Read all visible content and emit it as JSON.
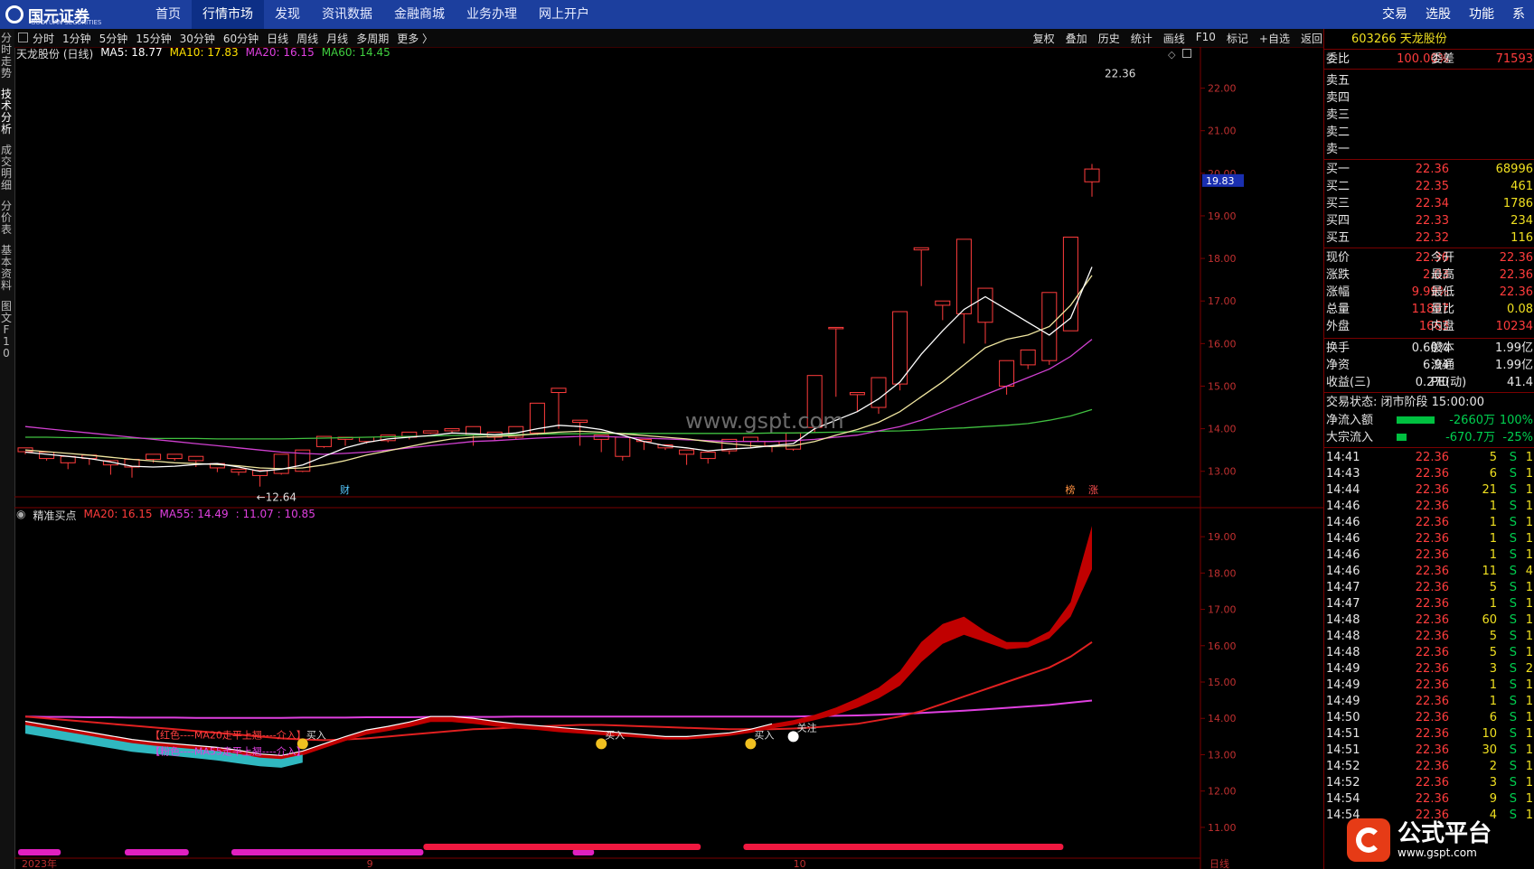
{
  "nav": {
    "logo_text": "国元证券",
    "logo_sub": "GUOYUAN SECURITIES",
    "items": [
      "首页",
      "行情市场",
      "发现",
      "资讯数据",
      "金融商城",
      "业务办理",
      "网上开户"
    ],
    "active_index": 1,
    "right_items": [
      "交易",
      "选股",
      "功能",
      "系"
    ]
  },
  "left_tabs": [
    "分时走势",
    "技术分析",
    "成交明细",
    "分价表",
    "基本资料",
    "图文F10"
  ],
  "left_tab_active": 1,
  "periods": [
    "分时",
    "1分钟",
    "5分钟",
    "15分钟",
    "30分钟",
    "60分钟",
    "日线",
    "周线",
    "月线",
    "多周期",
    "更多 〉"
  ],
  "tools": [
    "复权",
    "叠加",
    "历史",
    "统计",
    "画线",
    "F10",
    "标记",
    "+自选",
    "返回"
  ],
  "main_legend": {
    "name": "天龙股份 (日线)",
    "items": [
      {
        "text": "MA5: 18.77",
        "color": "#ffffff"
      },
      {
        "text": "MA10: 17.83",
        "color": "#ffe000"
      },
      {
        "text": "MA20: 16.15",
        "color": "#e040e0"
      },
      {
        "text": "MA60: 14.45",
        "color": "#40d040"
      }
    ]
  },
  "sub_legend": {
    "name": "精准买点",
    "items": [
      {
        "text": "MA20: 16.15",
        "color": "#ff3c3c"
      },
      {
        "text": "MA55: 14.49",
        "color": "#e040e0"
      },
      {
        "text": ": 11.07 : 10.85",
        "color": "#e040e0"
      }
    ]
  },
  "price_axis": [
    "22.00",
    "21.00",
    "20.00",
    "19.00",
    "18.00",
    "17.00",
    "16.00",
    "15.00",
    "14.00",
    "13.00"
  ],
  "price_marker": "19.83",
  "sub_axis": [
    "19.00",
    "18.00",
    "17.00",
    "16.00",
    "15.00",
    "14.00",
    "13.00",
    "12.00",
    "11.00"
  ],
  "high_label": "22.36",
  "low_label": "12.64",
  "badges": {
    "cai": "财",
    "bang": "榜",
    "zhang": "涨"
  },
  "annotations": {
    "red_text": "【红色----MA20走平上翘----介入】",
    "pink_text": "【粉色----MA55走平上翘----介入】",
    "buy1": "买入",
    "buy2": "买入",
    "buy3": "买入",
    "watch": "关注"
  },
  "date_labels": [
    "2023年",
    "9",
    "10"
  ],
  "axis_unit": "日线",
  "watermark": "www.gspt.com",
  "quote": {
    "title": "603266 天龙股份",
    "weibi_label": "委比",
    "weibi": "100.00%",
    "weicha_label": "委差",
    "weicha": "71593",
    "asks": [
      "卖五",
      "卖四",
      "卖三",
      "卖二",
      "卖一"
    ],
    "bids": [
      {
        "label": "买一",
        "price": "22.36",
        "vol": "68996"
      },
      {
        "label": "买二",
        "price": "22.35",
        "vol": "461"
      },
      {
        "label": "买三",
        "price": "22.34",
        "vol": "1786"
      },
      {
        "label": "买四",
        "price": "22.33",
        "vol": "234"
      },
      {
        "label": "买五",
        "price": "22.32",
        "vol": "116"
      }
    ],
    "stats": [
      {
        "l1": "现价",
        "v1": "22.36",
        "l2": "今开",
        "v2": "22.36"
      },
      {
        "l1": "涨跌",
        "v1": "2.03",
        "l2": "最高",
        "v2": "22.36"
      },
      {
        "l1": "涨幅",
        "v1": "9.99%",
        "l2": "最低",
        "v2": "22.36"
      },
      {
        "l1": "总量",
        "v1": "11897",
        "l2": "量比",
        "v2": "0.08"
      },
      {
        "l1": "外盘",
        "v1": "1663",
        "l2": "内盘",
        "v2": "10234"
      }
    ],
    "stats2": [
      {
        "l1": "换手",
        "v1": "0.60%",
        "l2": "股本",
        "v2": "1.99亿"
      },
      {
        "l1": "净资",
        "v1": "6.94",
        "l2": "流通",
        "v2": "1.99亿"
      },
      {
        "l1": "收益(三)",
        "v1": "0.270",
        "l2": "PE(动)",
        "v2": "41.4"
      }
    ],
    "trade_status": "交易状态: 闭市阶段 15:00:00",
    "flows": [
      {
        "label": "净流入额",
        "value": "-2660万",
        "pct": "100%",
        "bar": 0.7
      },
      {
        "label": "大宗流入",
        "value": "-670.7万",
        "pct": "-25%",
        "bar": 0.18
      }
    ],
    "ticks": [
      [
        "14:41",
        "22.36",
        "5",
        "S",
        "1"
      ],
      [
        "14:43",
        "22.36",
        "6",
        "S",
        "1"
      ],
      [
        "14:44",
        "22.36",
        "21",
        "S",
        "1"
      ],
      [
        "14:46",
        "22.36",
        "1",
        "S",
        "1"
      ],
      [
        "14:46",
        "22.36",
        "1",
        "S",
        "1"
      ],
      [
        "14:46",
        "22.36",
        "1",
        "S",
        "1"
      ],
      [
        "14:46",
        "22.36",
        "1",
        "S",
        "1"
      ],
      [
        "14:46",
        "22.36",
        "11",
        "S",
        "4"
      ],
      [
        "14:47",
        "22.36",
        "5",
        "S",
        "1"
      ],
      [
        "14:47",
        "22.36",
        "1",
        "S",
        "1"
      ],
      [
        "14:48",
        "22.36",
        "60",
        "S",
        "1"
      ],
      [
        "14:48",
        "22.36",
        "5",
        "S",
        "1"
      ],
      [
        "14:48",
        "22.36",
        "5",
        "S",
        "1"
      ],
      [
        "14:49",
        "22.36",
        "3",
        "S",
        "2"
      ],
      [
        "14:49",
        "22.36",
        "1",
        "S",
        "1"
      ],
      [
        "14:49",
        "22.36",
        "1",
        "S",
        "1"
      ],
      [
        "14:50",
        "22.36",
        "6",
        "S",
        "1"
      ],
      [
        "14:51",
        "22.36",
        "10",
        "S",
        "1"
      ],
      [
        "14:51",
        "22.36",
        "30",
        "S",
        "1"
      ],
      [
        "14:52",
        "22.36",
        "2",
        "S",
        "1"
      ],
      [
        "14:52",
        "22.36",
        "3",
        "S",
        "1"
      ],
      [
        "14:54",
        "22.36",
        "9",
        "S",
        "1"
      ],
      [
        "14:54",
        "22.36",
        "4",
        "S",
        "1"
      ]
    ]
  },
  "brand": {
    "name": "公式平台",
    "url": "www.gspt.com"
  },
  "chart_data": {
    "type": "candlestick",
    "price_range": [
      12.4,
      22.5
    ],
    "candles": [
      [
        13.46,
        13.55,
        13.4,
        13.5
      ],
      [
        13.3,
        13.45,
        13.25,
        13.4
      ],
      [
        13.2,
        13.35,
        13.05,
        13.1
      ],
      [
        13.3,
        13.38,
        13.15,
        13.22
      ],
      [
        13.15,
        13.25,
        12.92,
        12.98
      ],
      [
        13.1,
        13.28,
        12.85,
        12.92
      ],
      [
        13.28,
        13.4,
        13.2,
        13.35
      ],
      [
        13.3,
        13.4,
        13.25,
        13.3
      ],
      [
        13.25,
        13.35,
        13.1,
        13.25
      ],
      [
        13.08,
        13.18,
        12.98,
        13.02
      ],
      [
        12.98,
        13.05,
        12.9,
        12.98
      ],
      [
        12.9,
        13.02,
        12.64,
        12.7
      ],
      [
        12.95,
        13.4,
        12.92,
        13.35
      ],
      [
        13.0,
        13.5,
        12.98,
        13.45
      ],
      [
        13.58,
        13.82,
        13.55,
        13.75
      ],
      [
        13.75,
        13.8,
        13.6,
        13.72
      ],
      [
        13.7,
        13.8,
        13.65,
        13.75
      ],
      [
        13.72,
        13.85,
        13.68,
        13.8
      ],
      [
        13.8,
        13.92,
        13.75,
        13.85
      ],
      [
        13.9,
        13.95,
        13.88,
        13.92
      ],
      [
        13.95,
        14.0,
        13.9,
        13.95
      ],
      [
        13.85,
        14.05,
        13.6,
        13.65
      ],
      [
        13.8,
        13.92,
        13.72,
        13.88
      ],
      [
        13.8,
        14.05,
        13.75,
        14.0
      ],
      [
        13.9,
        14.6,
        13.85,
        14.55
      ],
      [
        14.85,
        14.95,
        14.0,
        14.05
      ],
      [
        14.15,
        14.2,
        13.6,
        13.75
      ],
      [
        13.75,
        13.85,
        13.45,
        13.5
      ],
      [
        13.35,
        13.8,
        13.25,
        13.78
      ],
      [
        13.7,
        13.75,
        13.5,
        13.55
      ],
      [
        13.55,
        13.62,
        13.5,
        13.56
      ],
      [
        13.4,
        13.5,
        13.15,
        13.2
      ],
      [
        13.3,
        13.45,
        13.18,
        13.4
      ],
      [
        13.48,
        13.75,
        13.4,
        13.7
      ],
      [
        13.7,
        13.8,
        13.55,
        13.72
      ],
      [
        13.6,
        13.7,
        13.45,
        13.5
      ],
      [
        13.52,
        13.9,
        13.48,
        13.8
      ],
      [
        14.03,
        15.25,
        13.9,
        15.22
      ],
      [
        16.35,
        16.38,
        14.75,
        14.8
      ],
      [
        14.8,
        14.85,
        14.4,
        14.45
      ],
      [
        14.5,
        15.2,
        14.35,
        15.15
      ],
      [
        15.05,
        16.75,
        14.9,
        16.65
      ],
      [
        18.2,
        18.25,
        17.35,
        17.35
      ],
      [
        16.9,
        17.0,
        16.55,
        16.8
      ],
      [
        16.7,
        18.45,
        16.0,
        17.75
      ],
      [
        16.5,
        17.3,
        16.0,
        16.0
      ],
      [
        15.0,
        15.6,
        14.8,
        15.25
      ],
      [
        15.5,
        15.85,
        15.4,
        15.85
      ],
      [
        15.6,
        17.2,
        15.5,
        16.75
      ],
      [
        16.3,
        18.5,
        16.3,
        18.5
      ],
      [
        19.8,
        20.1,
        19.45,
        20.22
      ]
    ],
    "ma5": [
      13.45,
      13.4,
      13.35,
      13.3,
      13.22,
      13.12,
      13.1,
      13.12,
      13.16,
      13.18,
      13.1,
      13.0,
      13.05,
      13.15,
      13.35,
      13.55,
      13.68,
      13.76,
      13.8,
      13.84,
      13.9,
      13.88,
      13.86,
      13.9,
      14.0,
      14.08,
      14.05,
      13.98,
      13.85,
      13.7,
      13.6,
      13.55,
      13.48,
      13.52,
      13.55,
      13.6,
      13.65,
      14.0,
      14.2,
      14.4,
      14.7,
      15.1,
      15.75,
      16.3,
      16.8,
      17.1,
      16.8,
      16.5,
      16.2,
      16.6,
      17.8
    ],
    "ma10": [
      13.5,
      13.46,
      13.42,
      13.38,
      13.33,
      13.28,
      13.24,
      13.2,
      13.18,
      13.16,
      13.13,
      13.08,
      13.06,
      13.08,
      13.15,
      13.25,
      13.38,
      13.48,
      13.58,
      13.68,
      13.76,
      13.8,
      13.82,
      13.84,
      13.88,
      13.92,
      13.94,
      13.92,
      13.88,
      13.84,
      13.8,
      13.76,
      13.7,
      13.65,
      13.6,
      13.58,
      13.6,
      13.7,
      13.85,
      13.98,
      14.15,
      14.4,
      14.75,
      15.1,
      15.5,
      15.9,
      16.1,
      16.2,
      16.4,
      16.9,
      17.6
    ],
    "ma20": [
      14.05,
      14.0,
      13.95,
      13.9,
      13.85,
      13.8,
      13.75,
      13.7,
      13.65,
      13.6,
      13.55,
      13.5,
      13.45,
      13.42,
      13.4,
      13.42,
      13.45,
      13.5,
      13.55,
      13.6,
      13.65,
      13.7,
      13.72,
      13.75,
      13.78,
      13.8,
      13.82,
      13.82,
      13.8,
      13.78,
      13.76,
      13.74,
      13.72,
      13.7,
      13.7,
      13.7,
      13.72,
      13.75,
      13.8,
      13.85,
      13.95,
      14.05,
      14.2,
      14.4,
      14.6,
      14.8,
      15.0,
      15.2,
      15.4,
      15.7,
      16.1
    ],
    "ma60": [
      13.8,
      13.8,
      13.79,
      13.79,
      13.78,
      13.78,
      13.77,
      13.77,
      13.77,
      13.76,
      13.76,
      13.76,
      13.76,
      13.77,
      13.78,
      13.79,
      13.8,
      13.81,
      13.82,
      13.83,
      13.84,
      13.85,
      13.86,
      13.86,
      13.87,
      13.88,
      13.88,
      13.89,
      13.89,
      13.89,
      13.89,
      13.89,
      13.89,
      13.89,
      13.89,
      13.9,
      13.9,
      13.91,
      13.92,
      13.93,
      13.94,
      13.95,
      13.97,
      14.0,
      14.02,
      14.05,
      14.08,
      14.12,
      14.2,
      14.3,
      14.45
    ],
    "sub": {
      "range": [
        10.6,
        19.6
      ],
      "ma20": [
        14.05,
        14.0,
        13.95,
        13.9,
        13.85,
        13.8,
        13.75,
        13.7,
        13.65,
        13.6,
        13.55,
        13.5,
        13.45,
        13.42,
        13.4,
        13.42,
        13.45,
        13.5,
        13.55,
        13.6,
        13.65,
        13.7,
        13.72,
        13.75,
        13.78,
        13.8,
        13.82,
        13.82,
        13.8,
        13.78,
        13.76,
        13.74,
        13.72,
        13.7,
        13.7,
        13.7,
        13.72,
        13.75,
        13.8,
        13.85,
        13.95,
        14.05,
        14.2,
        14.4,
        14.6,
        14.8,
        15.0,
        15.2,
        15.4,
        15.7,
        16.1
      ],
      "ma55": [
        14.05,
        14.04,
        14.04,
        14.03,
        14.03,
        14.02,
        14.02,
        14.02,
        14.01,
        14.01,
        14.01,
        14.01,
        14.01,
        14.02,
        14.02,
        14.02,
        14.03,
        14.03,
        14.03,
        14.04,
        14.04,
        14.04,
        14.04,
        14.05,
        14.05,
        14.05,
        14.05,
        14.05,
        14.05,
        14.05,
        14.05,
        14.05,
        14.05,
        14.05,
        14.05,
        14.05,
        14.05,
        14.06,
        14.07,
        14.08,
        14.1,
        14.12,
        14.15,
        14.18,
        14.21,
        14.25,
        14.29,
        14.33,
        14.37,
        14.43,
        14.49
      ],
      "upper": [
        13.92,
        13.82,
        13.72,
        13.62,
        13.52,
        13.42,
        13.35,
        13.3,
        13.25,
        13.2,
        13.12,
        13.02,
        12.98,
        13.1,
        13.3,
        13.5,
        13.68,
        13.78,
        13.9,
        14.05,
        14.05,
        14.0,
        13.92,
        13.85,
        13.8,
        13.75,
        13.7,
        13.65,
        13.6,
        13.55,
        13.5,
        13.5,
        13.55,
        13.6,
        13.7,
        13.85,
        13.95,
        14.1,
        14.3,
        14.55,
        14.85,
        15.3,
        16.1,
        16.6,
        16.8,
        16.4,
        16.1,
        16.1,
        16.4,
        17.2,
        19.3
      ],
      "lower": [
        13.78,
        13.68,
        13.58,
        13.48,
        13.38,
        13.28,
        13.22,
        13.16,
        13.1,
        13.04,
        12.96,
        12.88,
        12.84,
        12.98,
        13.18,
        13.38,
        13.55,
        13.65,
        13.76,
        13.9,
        13.9,
        13.85,
        13.78,
        13.72,
        13.68,
        13.62,
        13.58,
        13.54,
        13.5,
        13.46,
        13.42,
        13.42,
        13.46,
        13.52,
        13.6,
        13.72,
        13.82,
        13.95,
        14.1,
        14.3,
        14.55,
        14.9,
        15.55,
        16.05,
        16.3,
        16.1,
        15.9,
        15.95,
        16.2,
        16.8,
        18.1
      ],
      "bars_top": [
        [
          0,
          2
        ],
        [
          5,
          8
        ],
        [
          10,
          19
        ],
        [
          26,
          27
        ]
      ],
      "bars_bottom": [
        [
          19,
          32
        ],
        [
          34,
          49
        ]
      ]
    }
  }
}
